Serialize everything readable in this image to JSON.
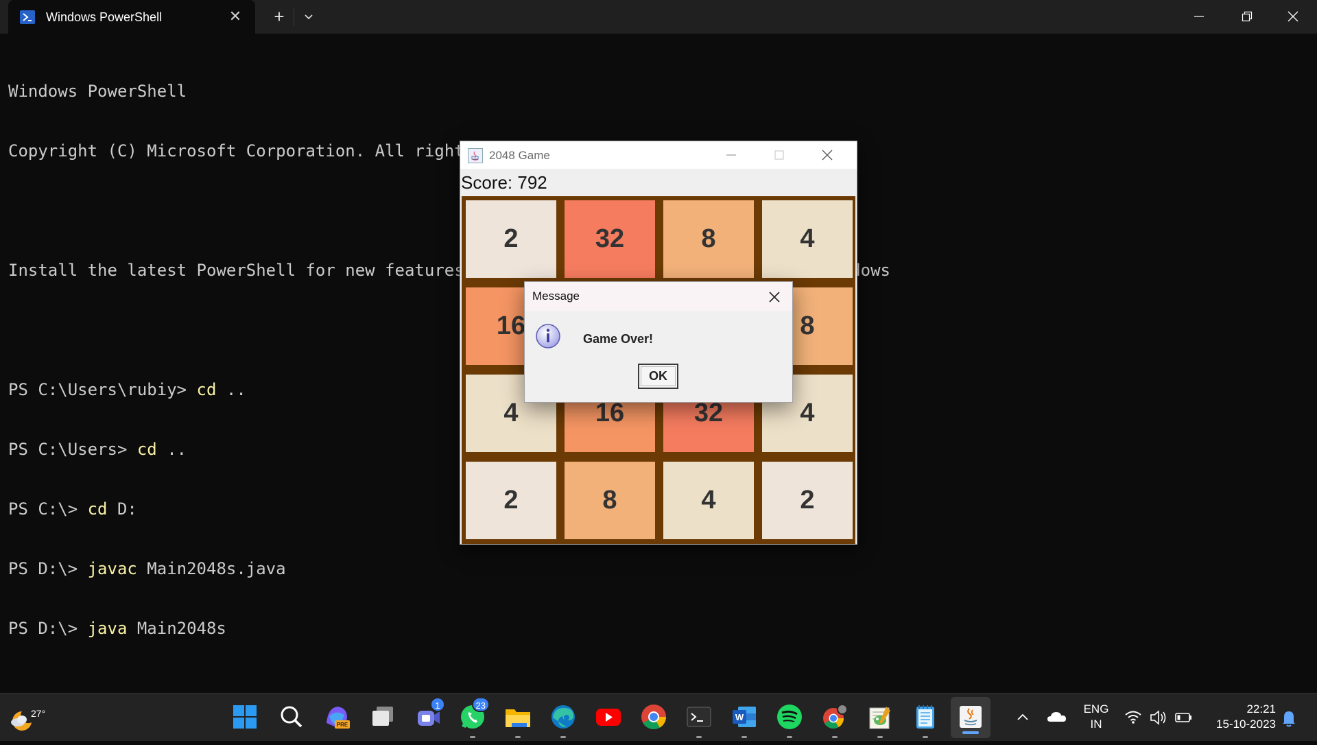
{
  "terminal": {
    "tab_title": "Windows PowerShell",
    "lines": [
      {
        "prompt": "Windows PowerShell",
        "cmd": ""
      },
      {
        "prompt": "Copyright (C) Microsoft Corporation. All rights reserved.",
        "cmd": ""
      },
      {
        "prompt": "",
        "cmd": ""
      },
      {
        "prompt": "Install the latest PowerShell for new features and improvements! https://aka.ms/PSWindows",
        "cmd": ""
      },
      {
        "prompt": "",
        "cmd": ""
      },
      {
        "prompt": "PS C:\\Users\\rubiy> ",
        "cmd": "cd",
        "rest": " .."
      },
      {
        "prompt": "PS C:\\Users> ",
        "cmd": "cd",
        "rest": " .."
      },
      {
        "prompt": "PS C:\\> ",
        "cmd": "cd",
        "rest": " D:"
      },
      {
        "prompt": "PS D:\\> ",
        "cmd": "javac",
        "rest": " Main2048s.java"
      },
      {
        "prompt": "PS D:\\> ",
        "cmd": "java",
        "rest": " Main2048s"
      }
    ]
  },
  "game": {
    "title": "2048 Game",
    "score_label": "Score: 792",
    "tiles": [
      [
        "2",
        "32",
        "8",
        "4"
      ],
      [
        "16",
        "",
        "",
        "8"
      ],
      [
        "4",
        "16",
        "32",
        "4"
      ],
      [
        "2",
        "8",
        "4",
        "2"
      ]
    ],
    "tile_colors": {
      "2": "#eee4da",
      "4": "#ede0c8",
      "8": "#f2b179",
      "16": "#f59563",
      "32": "#f67c5f"
    }
  },
  "dialog": {
    "title": "Message",
    "message": "Game Over!",
    "ok_label": "OK"
  },
  "taskbar": {
    "temperature": "27°",
    "lang_line1": "ENG",
    "lang_line2": "IN",
    "time": "22:21",
    "date": "15-10-2023",
    "teams_badge": "1",
    "whatsapp_badge": "23",
    "apps": [
      "start-icon",
      "search-icon",
      "copilot-icon",
      "task-view-icon",
      "teams-icon",
      "whatsapp-icon",
      "file-explorer-icon",
      "edge-icon",
      "youtube-icon",
      "chrome-icon",
      "terminal-icon",
      "word-icon",
      "spotify-icon",
      "chrome-profile-icon",
      "notepad-plus-icon",
      "notepad-icon",
      "java-icon"
    ]
  }
}
